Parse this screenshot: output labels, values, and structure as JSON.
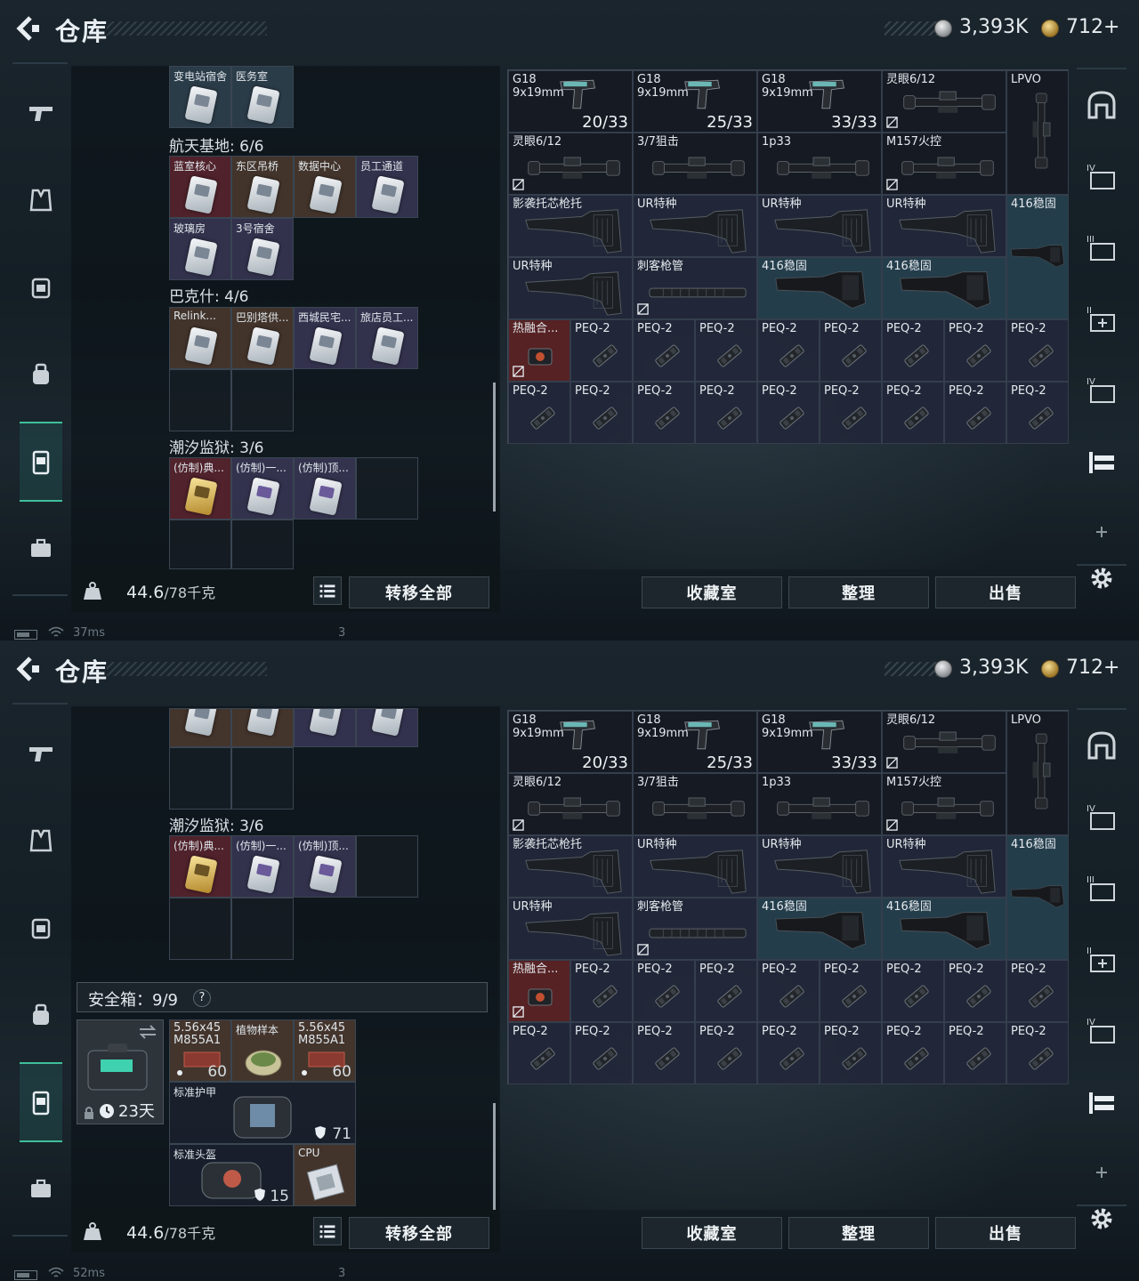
{
  "header": {
    "title": "仓库",
    "currency1": "3,393K",
    "currency2": "712+"
  },
  "left_nav": [
    {
      "name": "weapons",
      "icon": "pistol-icon"
    },
    {
      "name": "armor",
      "icon": "vest-icon"
    },
    {
      "name": "backpack",
      "icon": "backpack-icon"
    },
    {
      "name": "bag",
      "icon": "bag-icon"
    },
    {
      "name": "keys",
      "icon": "keycard-icon"
    },
    {
      "name": "misc",
      "icon": "briefcase-icon"
    }
  ],
  "panel1": {
    "top_partial_cards": [
      "变电站宿舍",
      "医务室"
    ],
    "groups": [
      {
        "label": "航天基地: 6/6",
        "items": [
          "蓝室核心",
          "东区吊桥",
          "数据中心",
          "员工通道",
          "玻璃房",
          "3号宿舍"
        ]
      },
      {
        "label": "巴克什: 4/6",
        "items": [
          "Relink...",
          "巴别塔供...",
          "西城民宅...",
          "旅店员工..."
        ]
      },
      {
        "label": "潮汐监狱: 3/6",
        "items": [
          "(仿制)典...",
          "(仿制)一...",
          "(仿制)顶..."
        ]
      }
    ],
    "ping": "37ms"
  },
  "panel2": {
    "group": {
      "label": "潮汐监狱: 3/6",
      "items": [
        "(仿制)典...",
        "(仿制)一...",
        "(仿制)顶..."
      ]
    },
    "safe_label": "安全箱：9/9",
    "safe_q": "?",
    "safe_days": "23天",
    "safe_items": [
      {
        "name": "5.56x45 M855A1",
        "count": "60"
      },
      {
        "name": "植物样本",
        "count": ""
      },
      {
        "name": "5.56x45 M855A1",
        "count": "60"
      },
      {
        "name": "标准护甲",
        "count": "71"
      },
      {
        "name": "标准头盔",
        "count": "15"
      },
      {
        "name": "CPU",
        "count": ""
      }
    ],
    "ping": "52ms"
  },
  "grid": {
    "g18_name": "G18",
    "g18_cal": "9x19mm",
    "g18_counts": [
      "20/33",
      "25/33",
      "33/33"
    ],
    "row1": [
      "灵眼6/12",
      "LPVO"
    ],
    "row2": [
      "灵眼6/12",
      "3/7狙击",
      "1p33",
      "M157火控"
    ],
    "row3": [
      "影袭托芯枪托",
      "UR特种",
      "UR特种",
      "UR特种",
      "416稳固"
    ],
    "row4": [
      "UR特种",
      "刺客枪管",
      "416稳固",
      "416稳固"
    ],
    "row5_first": "热融合...",
    "peq": "PEQ-2"
  },
  "bottom": {
    "weight": "44.6",
    "weight_max": "/78千克",
    "transfer": "转移全部",
    "collection": "收藏室",
    "sort": "整理",
    "sell": "出售"
  },
  "status": {
    "three": "3"
  }
}
